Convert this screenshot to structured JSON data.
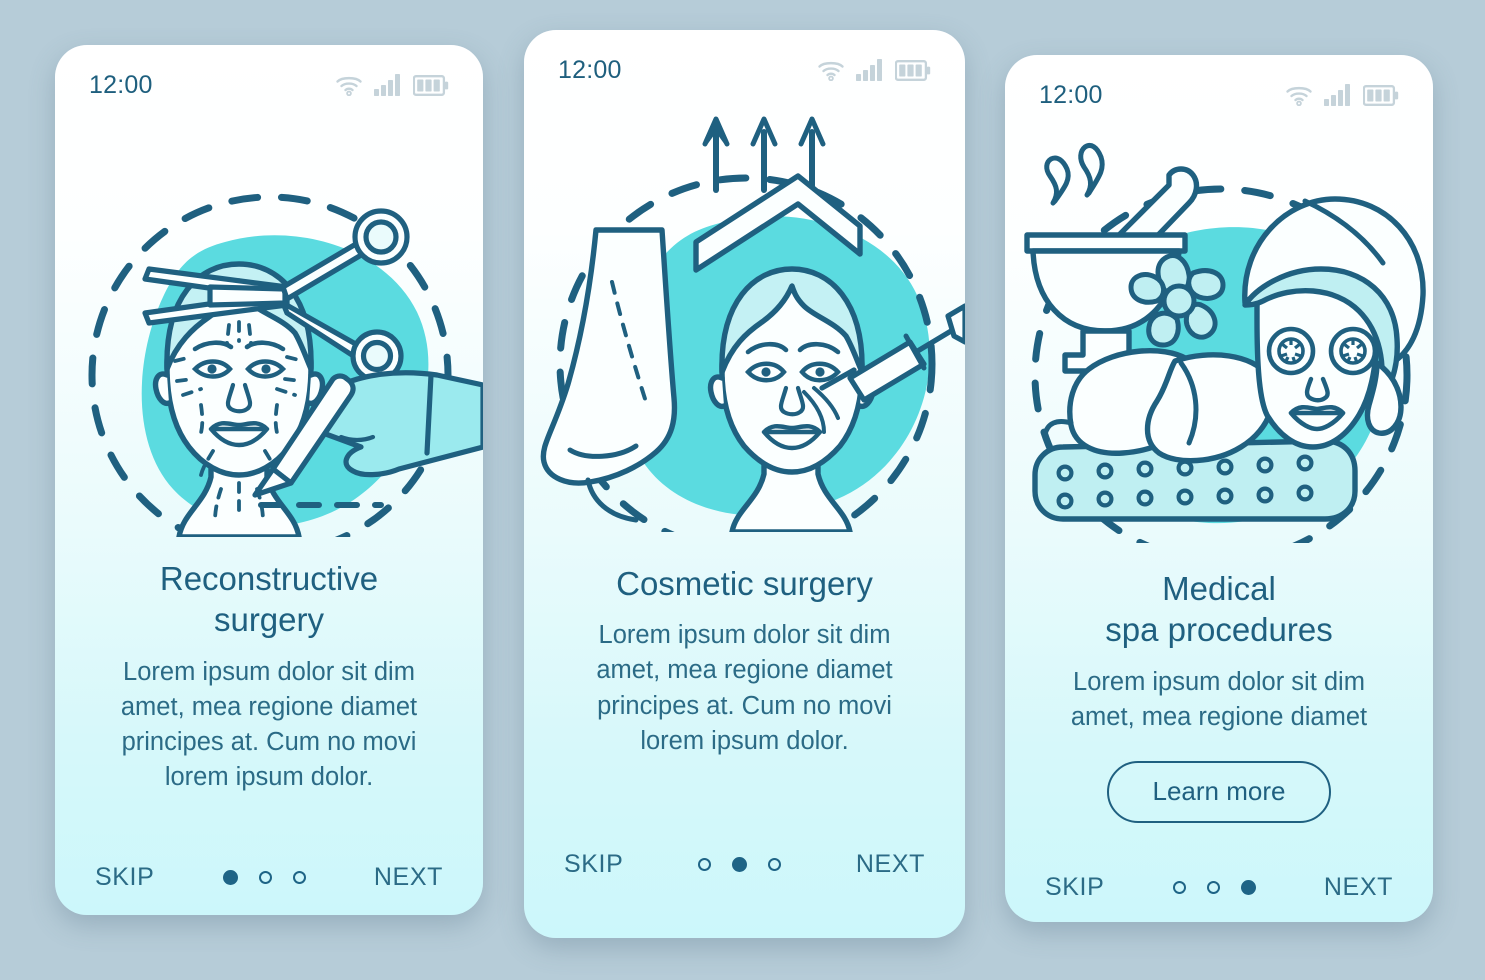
{
  "colors": {
    "page_background": "#b6ccd8",
    "card_top": "#ffffff",
    "card_bottom": "#ccf7fb",
    "accent_cyan": "#5bdbe0",
    "stroke_dark": "#1f6080",
    "text_title": "#1f6080",
    "text_body": "#2b6b86",
    "status_icon": "#c5d3da"
  },
  "screens": [
    {
      "status": {
        "time": "12:00",
        "icons": [
          "wifi-icon",
          "signal-icon",
          "battery-icon"
        ]
      },
      "illustration": "reconstructive-surgery-illustration",
      "title": "Reconstructive\nsurgery",
      "body": "Lorem ipsum dolor sit dim\namet, mea regione diamet\nprincipes at. Cum no movi\nlorem ipsum dolor.",
      "cta": null,
      "footer": {
        "skip": "SKIP",
        "next": "NEXT",
        "dots": 3,
        "active": 0
      }
    },
    {
      "status": {
        "time": "12:00",
        "icons": [
          "wifi-icon",
          "signal-icon",
          "battery-icon"
        ]
      },
      "illustration": "cosmetic-surgery-illustration",
      "title": "Cosmetic surgery",
      "body": "Lorem ipsum dolor sit dim\namet, mea regione diamet\nprincipes at. Cum no movi\nlorem ipsum dolor.",
      "cta": null,
      "footer": {
        "skip": "SKIP",
        "next": "NEXT",
        "dots": 3,
        "active": 1
      }
    },
    {
      "status": {
        "time": "12:00",
        "icons": [
          "wifi-icon",
          "signal-icon",
          "battery-icon"
        ]
      },
      "illustration": "medical-spa-illustration",
      "title": "Medical\nspa procedures",
      "body": "Lorem ipsum dolor sit dim\namet, mea regione diamet",
      "cta": "Learn more",
      "footer": {
        "skip": "SKIP",
        "next": "NEXT",
        "dots": 3,
        "active": 2
      }
    }
  ]
}
